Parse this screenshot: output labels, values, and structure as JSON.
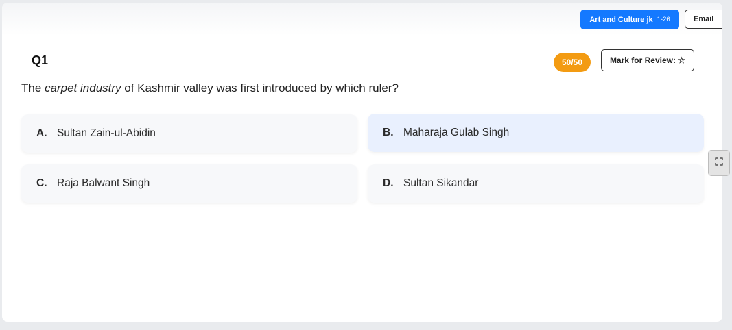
{
  "header": {
    "topic_label": "Art and Culture jk",
    "topic_range": "1-26",
    "email_label": "Email"
  },
  "question": {
    "number": "Q1",
    "score": "50/50",
    "review_label": "Mark for Review: ☆",
    "text_before": "The ",
    "text_emphasis": "carpet industry",
    "text_after": " of Kashmir valley was first introduced by which ruler?"
  },
  "options": [
    {
      "letter": "A.",
      "text": "Sultan Zain-ul-Abidin"
    },
    {
      "letter": "B.",
      "text": "Maharaja Gulab Singh"
    },
    {
      "letter": "C.",
      "text": "Raja Balwant Singh"
    },
    {
      "letter": "D.",
      "text": "Sultan Sikandar"
    }
  ],
  "side_controls": {
    "expand_icon": "fullscreen-icon"
  },
  "colors": {
    "topic_button": "#1479ff",
    "score_badge": "#f39b12",
    "highlighted_option": "#e9f0fe"
  }
}
